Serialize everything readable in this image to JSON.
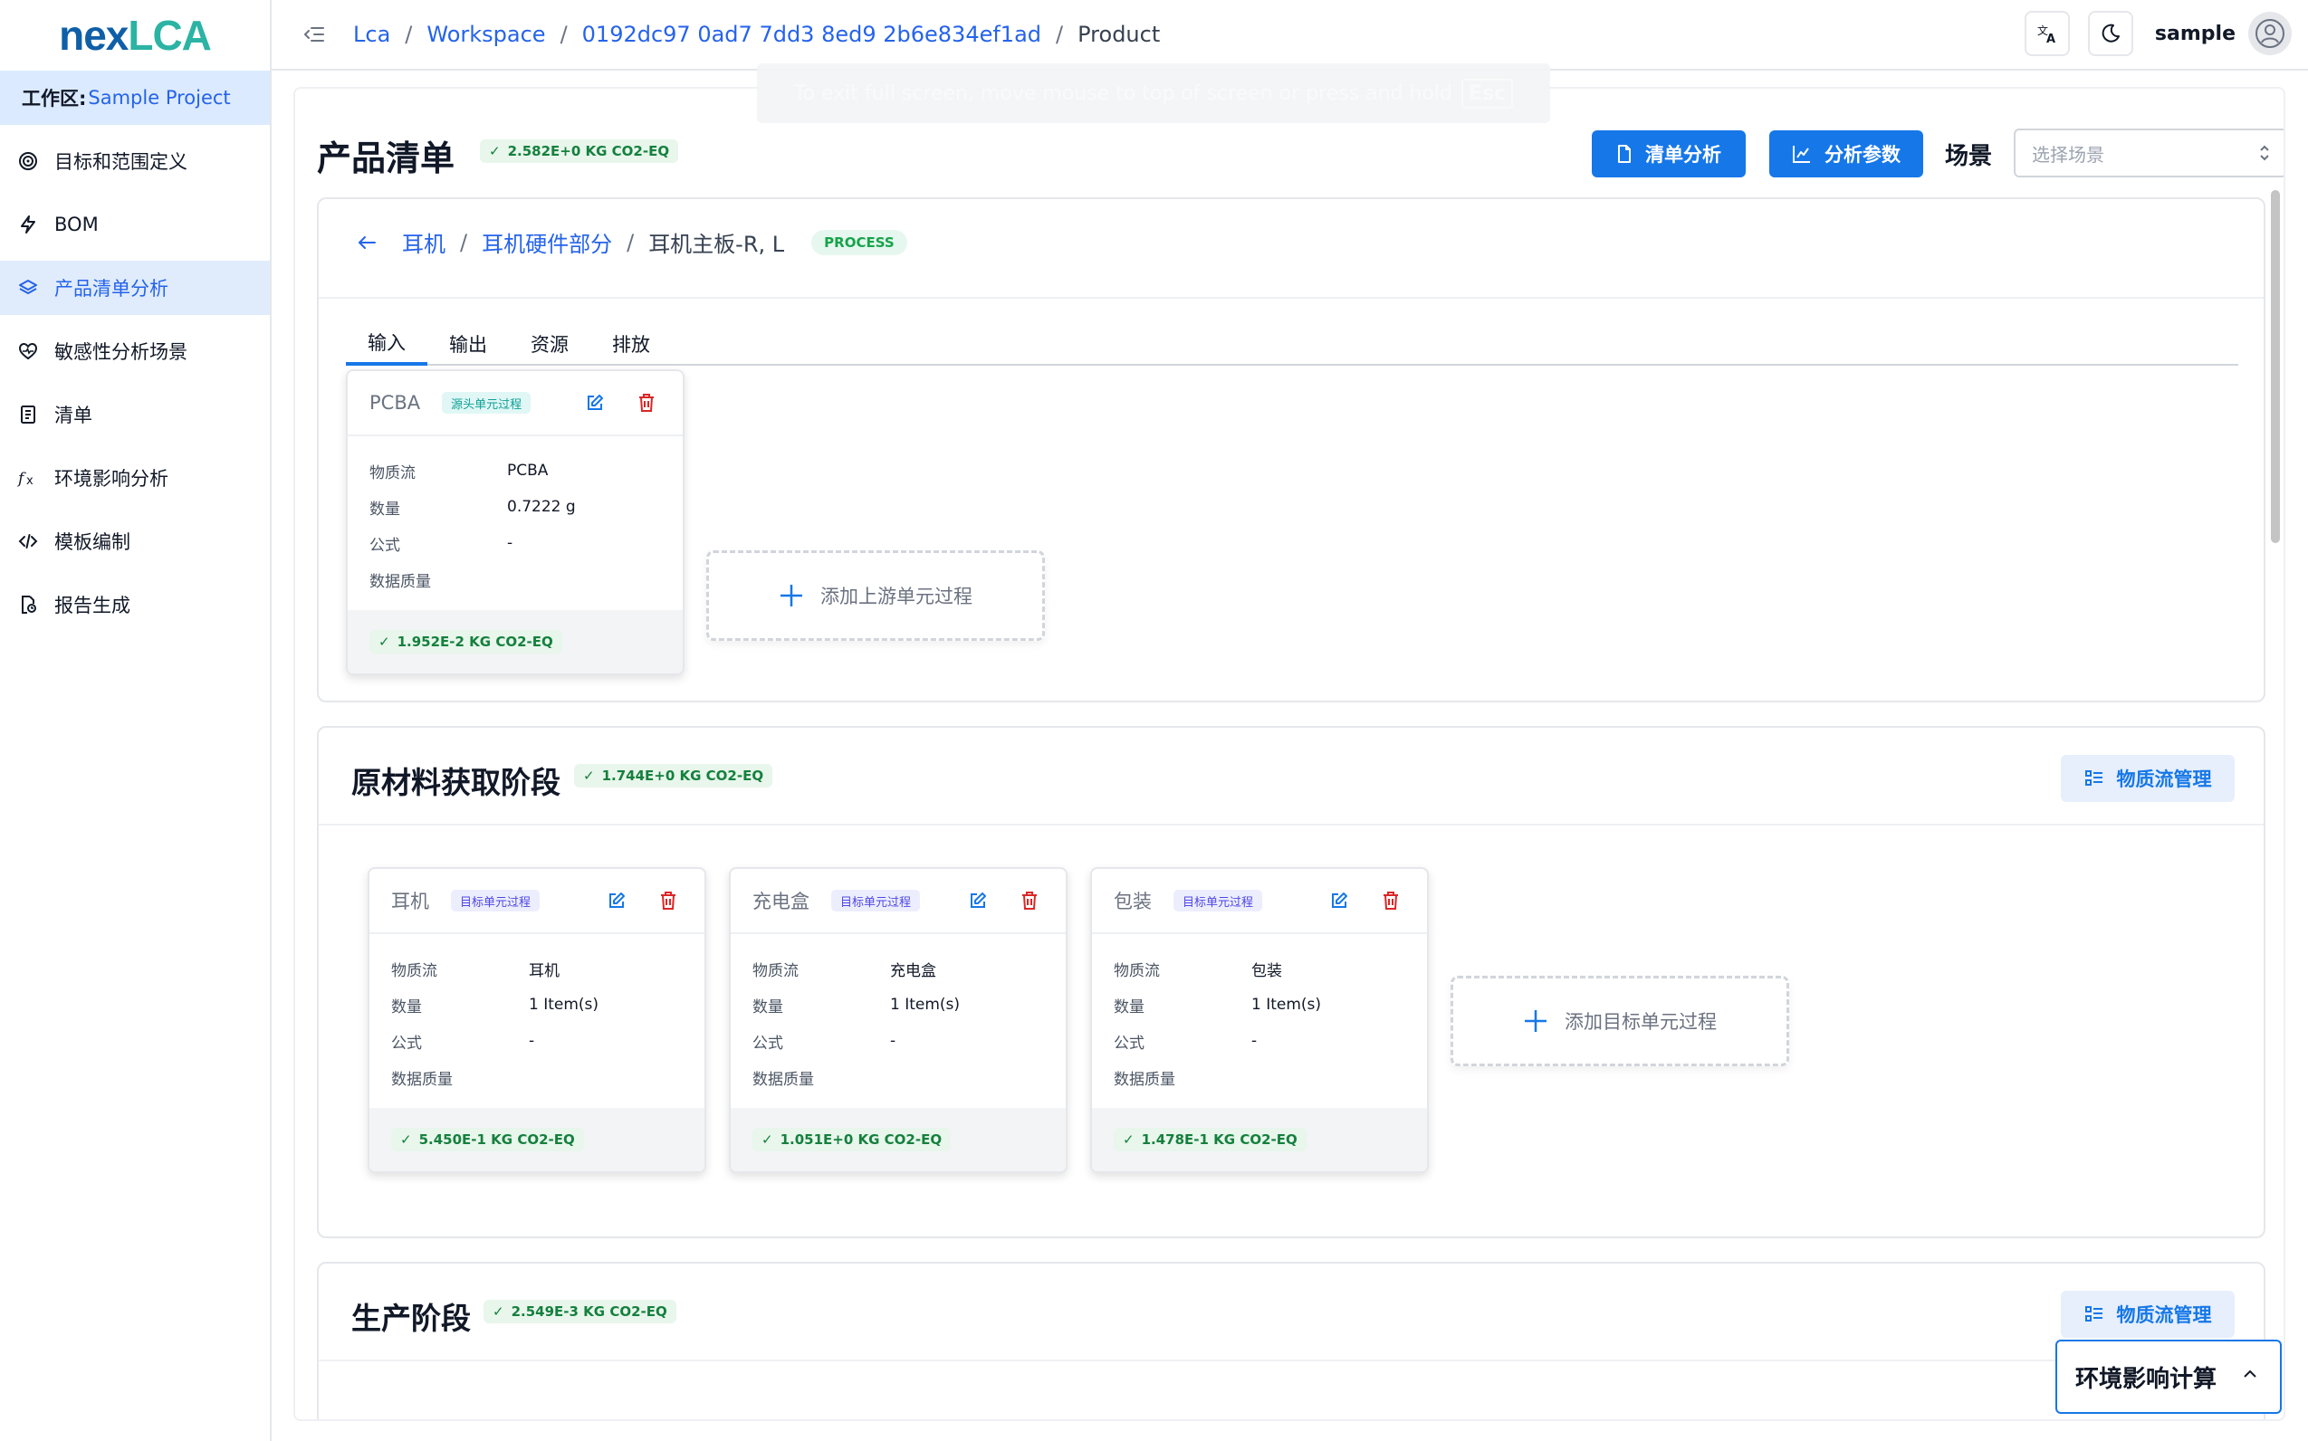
{
  "sidebar": {
    "logo": {
      "part1": "nex",
      "part2": "LCA"
    },
    "workspace": {
      "label": "工作区:",
      "name": "Sample Project"
    },
    "items": [
      {
        "label": "目标和范围定义",
        "icon": "target-icon"
      },
      {
        "label": "BOM",
        "icon": "bolt-icon"
      },
      {
        "label": "产品清单分析",
        "icon": "layers-icon",
        "active": true
      },
      {
        "label": "敏感性分析场景",
        "icon": "heart-pulse-icon"
      },
      {
        "label": "清单",
        "icon": "ledger-icon"
      },
      {
        "label": "环境影响分析",
        "icon": "function-icon"
      },
      {
        "label": "模板编制",
        "icon": "code-icon"
      },
      {
        "label": "报告生成",
        "icon": "report-icon"
      }
    ]
  },
  "header": {
    "breadcrumb": [
      "Lca",
      "Workspace",
      "0192dc97 0ad7 7dd3 8ed9 2b6e834ef1ad",
      "Product"
    ],
    "username": "sample"
  },
  "toast": {
    "text": "To exit full screen, move mouse to top of screen or press and hold",
    "key": "Esc"
  },
  "page": {
    "title": "产品清单",
    "total_badge": "2.582E+0 KG CO2-EQ",
    "btn_inventory": "清单分析",
    "btn_params": "分析参数",
    "scene_label": "场景",
    "scene_placeholder": "选择场景"
  },
  "process_panel": {
    "breadcrumb": [
      "耳机",
      "耳机硬件部分",
      "耳机主板-R, L"
    ],
    "type_badge": "PROCESS",
    "tabs": [
      "输入",
      "输出",
      "资源",
      "排放"
    ],
    "card": {
      "name": "PCBA",
      "tag": "源头单元过程",
      "rows": [
        {
          "k": "物质流",
          "v": "PCBA"
        },
        {
          "k": "数量",
          "v": "0.7222 g"
        },
        {
          "k": "公式",
          "v": "-"
        },
        {
          "k": "数据质量",
          "v": ""
        }
      ],
      "badge": "1.952E-2 KG CO2-EQ"
    },
    "add_label": "添加上游单元过程"
  },
  "raw_stage": {
    "title": "原材料获取阶段",
    "badge": "1.744E+0 KG CO2-EQ",
    "manage_label": "物质流管理",
    "cards": [
      {
        "name": "耳机",
        "tag": "目标单元过程",
        "rows": [
          {
            "k": "物质流",
            "v": "耳机"
          },
          {
            "k": "数量",
            "v": "1 Item(s)"
          },
          {
            "k": "公式",
            "v": "-"
          },
          {
            "k": "数据质量",
            "v": ""
          }
        ],
        "badge": "5.450E-1 KG CO2-EQ"
      },
      {
        "name": "充电盒",
        "tag": "目标单元过程",
        "rows": [
          {
            "k": "物质流",
            "v": "充电盒"
          },
          {
            "k": "数量",
            "v": "1 Item(s)"
          },
          {
            "k": "公式",
            "v": "-"
          },
          {
            "k": "数据质量",
            "v": ""
          }
        ],
        "badge": "1.051E+0 KG CO2-EQ"
      },
      {
        "name": "包装",
        "tag": "目标单元过程",
        "rows": [
          {
            "k": "物质流",
            "v": "包装"
          },
          {
            "k": "数量",
            "v": "1 Item(s)"
          },
          {
            "k": "公式",
            "v": "-"
          },
          {
            "k": "数据质量",
            "v": ""
          }
        ],
        "badge": "1.478E-1 KG CO2-EQ"
      }
    ],
    "add_label": "添加目标单元过程"
  },
  "production_stage": {
    "title": "生产阶段",
    "badge": "2.549E-3 KG CO2-EQ",
    "manage_label": "物质流管理"
  },
  "calc_button": {
    "label": "环境影响计算"
  },
  "colors": {
    "primary": "#1677e8",
    "success": "#15803d",
    "danger": "#dc2626",
    "sidebar_active": "#e0ecfb"
  }
}
